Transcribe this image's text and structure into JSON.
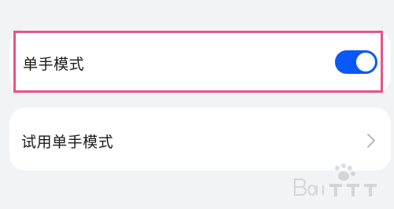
{
  "settings": {
    "one_hand_mode": {
      "label": "单手模式",
      "enabled": true
    },
    "try_one_hand_mode": {
      "label": "试用单手模式"
    }
  },
  "colors": {
    "background": "#f1f3f5",
    "toggle_on": "#0a59f7",
    "highlight": "#e8528a"
  },
  "icons": {
    "chevron": "chevron-right-icon",
    "watermark": "baidu-jingyan-watermark"
  }
}
